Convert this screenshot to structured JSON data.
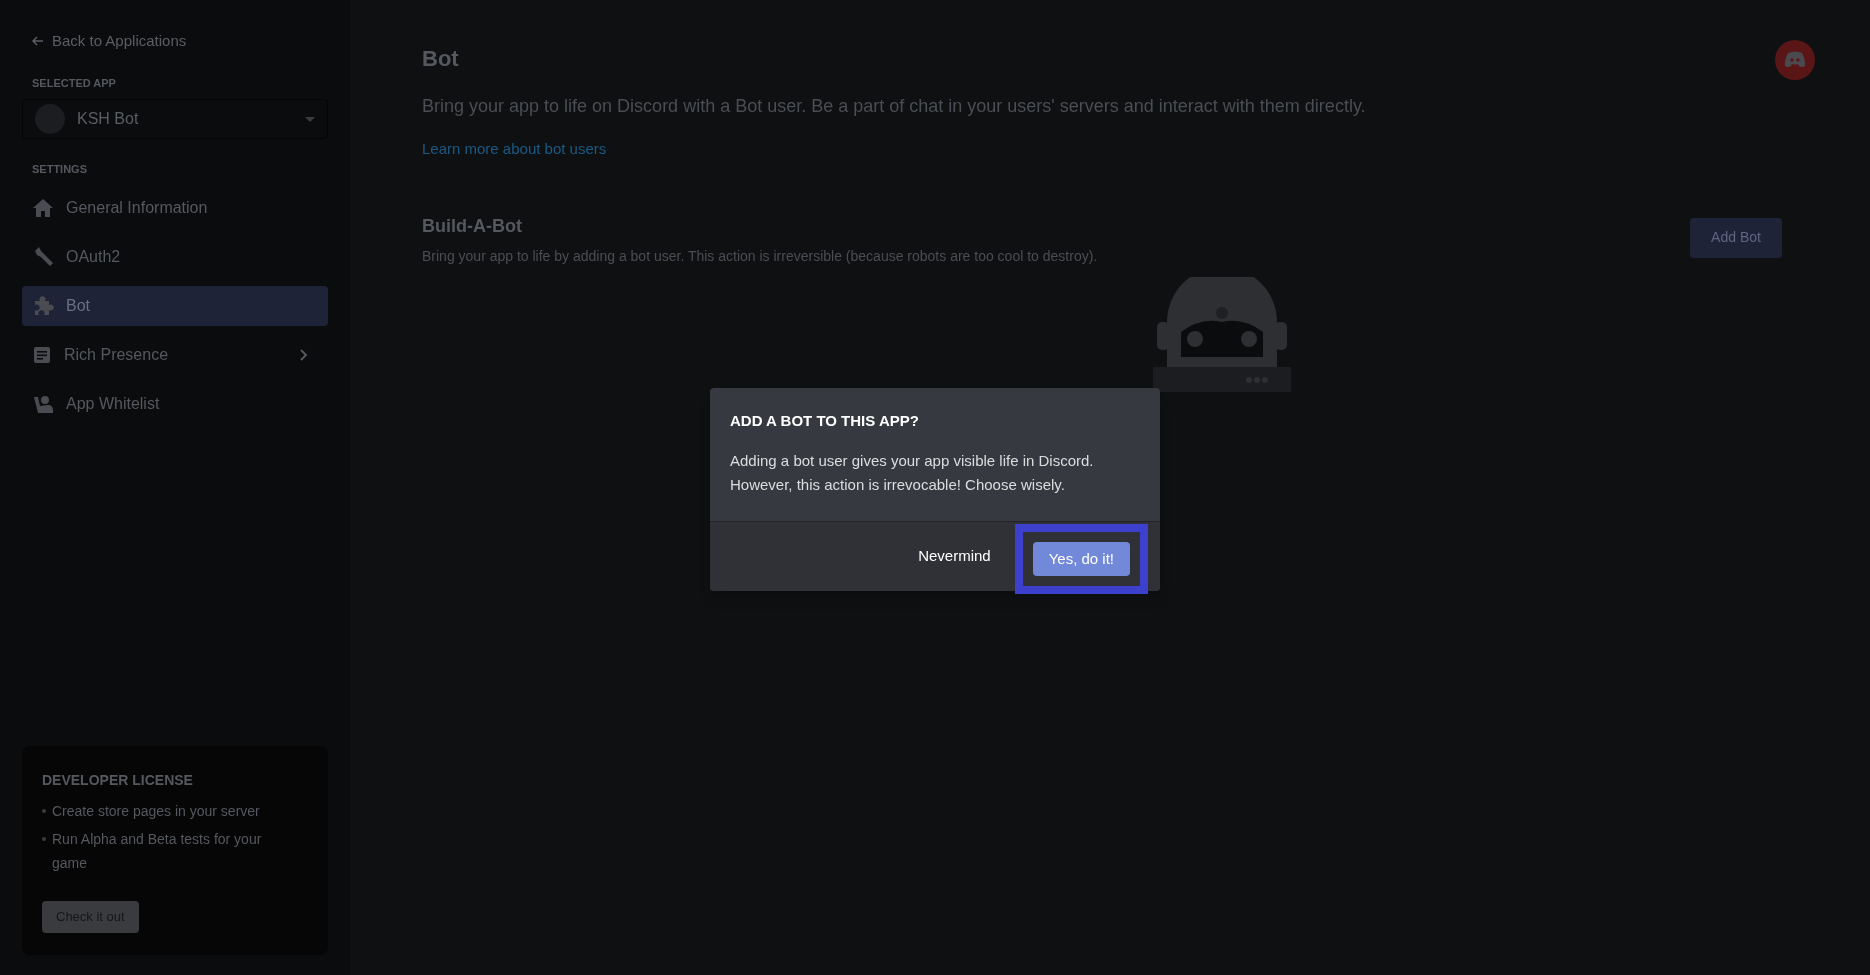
{
  "sidebar": {
    "back_link": "Back to Applications",
    "selected_app_label": "SELECTED APP",
    "selected_app": "KSH Bot",
    "settings_label": "SETTINGS",
    "items": [
      {
        "label": "General Information",
        "selected": false,
        "has_submenu": false
      },
      {
        "label": "OAuth2",
        "selected": false,
        "has_submenu": false
      },
      {
        "label": "Bot",
        "selected": true,
        "has_submenu": false
      },
      {
        "label": "Rich Presence",
        "selected": false,
        "has_submenu": true
      },
      {
        "label": "App Whitelist",
        "selected": false,
        "has_submenu": false
      }
    ],
    "license_card": {
      "title": "DEVELOPER LICENSE",
      "bullets": [
        "Create store pages in your server",
        "Run Alpha and Beta tests for your game"
      ],
      "button": "Check it out"
    }
  },
  "main": {
    "title": "Bot",
    "description": "Bring your app to life on Discord with a Bot user. Be a part of chat in your users' servers and interact with them directly.",
    "link": "Learn more about bot users",
    "section_title": "Build-A-Bot",
    "section_description": "Bring your app to life by adding a bot user. This action is irreversible (because robots are too cool to destroy).",
    "add_button": "Add Bot"
  },
  "dialog": {
    "title": "ADD A BOT TO THIS APP?",
    "body": "Adding a bot user gives your app visible life in Discord. However, this action is irrevocable! Choose wisely.",
    "buttons": [
      {
        "label": "Nevermind",
        "kind": "link",
        "highlighted": false
      },
      {
        "label": "Yes, do it!",
        "kind": "primary",
        "highlighted": true
      }
    ]
  }
}
